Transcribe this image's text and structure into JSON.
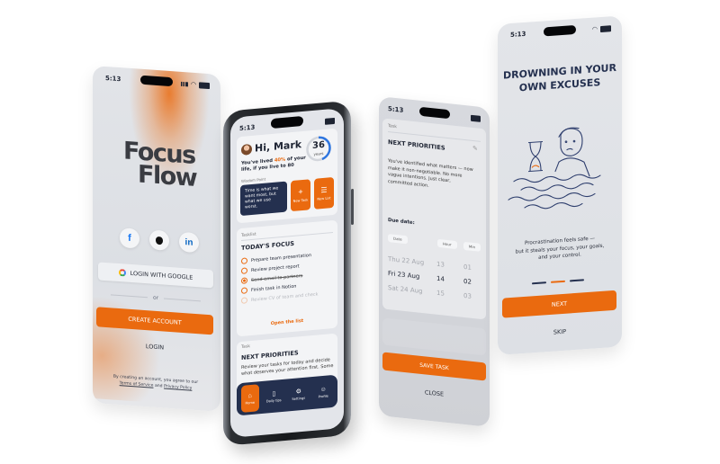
{
  "colors": {
    "accent": "#ea6a0f",
    "navy": "#24304f",
    "screen_bg": "#dfe1e6"
  },
  "phone1": {
    "time": "5:13",
    "logo_line1": "Focus",
    "logo_line2": "Flow",
    "social": [
      "f",
      "",
      "in"
    ],
    "google_label": "LOGIN WITH GOOGLE",
    "or_label": "or",
    "create_label": "CREATE ACCOUNT",
    "login_label": "LOGIN",
    "terms_pre": "By creating an account, you agree to our",
    "terms_link": "Terms of Service",
    "terms_and": "and",
    "privacy_link": "Privacy Policy"
  },
  "phone2": {
    "time": "5:13",
    "greeting": "Hi, Mark",
    "lived_pre": "You've lived ",
    "lived_pct": "40%",
    "lived_post": " of your life, if you live to 80",
    "years_value": "36",
    "years_unit": "years",
    "fact_label": "Wisdom Point",
    "quote": "Time is what we want most, but what we use worst.",
    "new_task": "New Task",
    "new_list": "New List",
    "tasklist_label": "Tasklist",
    "focus_title": "TODAY'S FOCUS",
    "tasks": [
      {
        "label": "Prepare team presentation",
        "state": "open"
      },
      {
        "label": "Review project report",
        "state": "open"
      },
      {
        "label": "Send email to partners",
        "state": "done"
      },
      {
        "label": "Finish task in Notion",
        "state": "open"
      },
      {
        "label": "Review CV of team and check",
        "state": "faded"
      }
    ],
    "open_list": "Open the list",
    "task_label": "Task",
    "next_title": "NEXT PRIORITIES",
    "next_text": "Review your tasks for today and decide what deserves your attention first. Some",
    "nav": [
      {
        "label": "Home",
        "icon": "home-icon",
        "active": true
      },
      {
        "label": "Daily tips",
        "icon": "book-icon",
        "active": false
      },
      {
        "label": "Settings",
        "icon": "gear-icon",
        "active": false
      },
      {
        "label": "Profile",
        "icon": "person-icon",
        "active": false
      }
    ]
  },
  "phone3": {
    "time": "5:13",
    "task_label": "Task",
    "title": "NEXT PRIORITIES",
    "body": "You've identified what matters — now make it non-negotiable. No more vague intentions. Just clear, committed action.",
    "due_label": "Due date:",
    "col_date": "Date",
    "col_hour": "Hour",
    "col_min": "Min",
    "rows": [
      {
        "date": "Thu 22 Aug",
        "hour": "13",
        "min": "01"
      },
      {
        "date": "Fri 23 Aug",
        "hour": "14",
        "min": "02"
      },
      {
        "date": "Sat 24 Aug",
        "hour": "15",
        "min": "03"
      }
    ],
    "save_label": "SAVE TASK",
    "close_label": "CLOSE"
  },
  "phone4": {
    "time": "5:13",
    "headline1": "DROWNING IN YOUR",
    "headline2": "OWN EXCUSES",
    "body1": "Procrastination feels safe —",
    "body2": "but it steals your focus, your goals,",
    "body3": "and your control.",
    "next_label": "NEXT",
    "skip_label": "SKIP"
  }
}
